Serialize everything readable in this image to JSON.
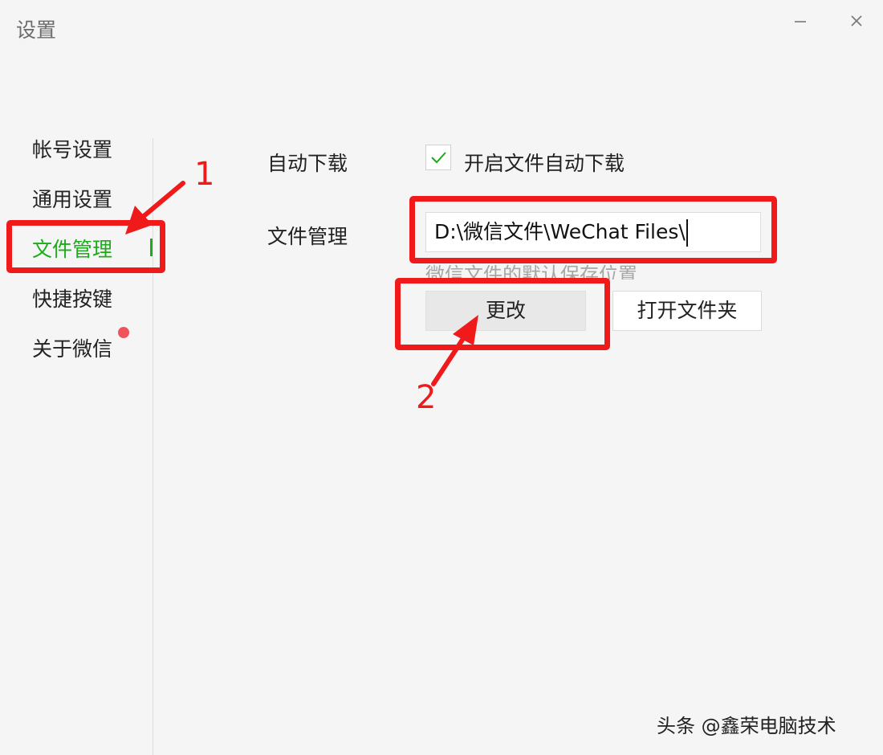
{
  "window": {
    "title": "设置"
  },
  "sidebar": {
    "items": [
      {
        "label": "帐号设置",
        "active": false
      },
      {
        "label": "通用设置",
        "active": false
      },
      {
        "label": "文件管理",
        "active": true
      },
      {
        "label": "快捷按键",
        "active": false
      },
      {
        "label": "关于微信",
        "active": false,
        "badge": true
      }
    ]
  },
  "content": {
    "auto_download": {
      "label": "自动下载",
      "checkbox_label": "开启文件自动下载",
      "checked": true
    },
    "file_management": {
      "label": "文件管理",
      "path_value": "D:\\微信文件\\WeChat Files\\",
      "hint": "微信文件的默认保存位置",
      "change_button": "更改",
      "open_folder_button": "打开文件夹"
    }
  },
  "annotations": {
    "step1": "1",
    "step2": "2"
  },
  "watermark": "头条 @鑫荣电脑技术",
  "colors": {
    "accent": "#1aad19",
    "annotation": "#f01a1a",
    "badge": "#f0535b"
  }
}
